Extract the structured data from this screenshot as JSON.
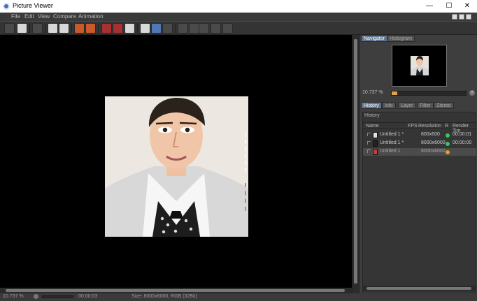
{
  "window": {
    "title": "Picture Viewer",
    "controls": {
      "minimize": "—",
      "maximize": "☐",
      "close": "✕"
    }
  },
  "menu": {
    "items": [
      "File",
      "Edit",
      "View",
      "Compare",
      "Animation"
    ]
  },
  "toolbar": {
    "tools": [
      {
        "icon": "open-folder-icon"
      },
      {
        "icon": "save-icon"
      },
      {
        "icon": "film-strip-icon"
      },
      {
        "icon": "move-icon"
      },
      {
        "icon": "user-icon"
      },
      {
        "icon": "copy-icon"
      },
      {
        "icon": "copy-alt-icon"
      },
      {
        "icon": "region-icon"
      },
      {
        "icon": "region-add-icon"
      },
      {
        "icon": "color-wheel-icon"
      },
      {
        "icon": "ab-icon"
      },
      {
        "icon": "fit-icon"
      },
      {
        "icon": "split-icon"
      },
      {
        "icon": "a-red-icon"
      },
      {
        "icon": "b-red-icon"
      },
      {
        "icon": "layer-icon"
      },
      {
        "icon": "grid-icon"
      },
      {
        "icon": "channels-icon"
      }
    ]
  },
  "navigator": {
    "tabs": [
      "Navigator",
      "Histogram"
    ],
    "zoom": "10.737 %",
    "zoom_fraction": 0.08
  },
  "panel": {
    "tabs": [
      "History",
      "Info",
      "Layer",
      "Filter",
      "Stereo"
    ],
    "history_title": "History",
    "columns": [
      "Name",
      "FPS",
      "Resolution",
      "R",
      "Render Tim"
    ],
    "rows": [
      {
        "name": "Untitled 1 *",
        "resolution": "800x600",
        "render_time": "00:00:01",
        "status_color": "#35c85a",
        "thumb_color": "#e0e0e0"
      },
      {
        "name": "Untitled 1 *",
        "resolution": "8000x6000",
        "render_time": "00:00:00",
        "status_color": "#35c85a",
        "thumb_color": "#222222"
      },
      {
        "name": "Untitled 1",
        "resolution": "8000x6000",
        "render_time": "",
        "status_color": "#e0a020",
        "thumb_color": "#c04040"
      }
    ]
  },
  "status": {
    "zoom": "10.737 %",
    "time": "00:00:03",
    "size": "Size: 8000x6000, RGB (32Bit)"
  },
  "colors": {
    "accent": "#61738d",
    "orange": "#e0a34a"
  }
}
